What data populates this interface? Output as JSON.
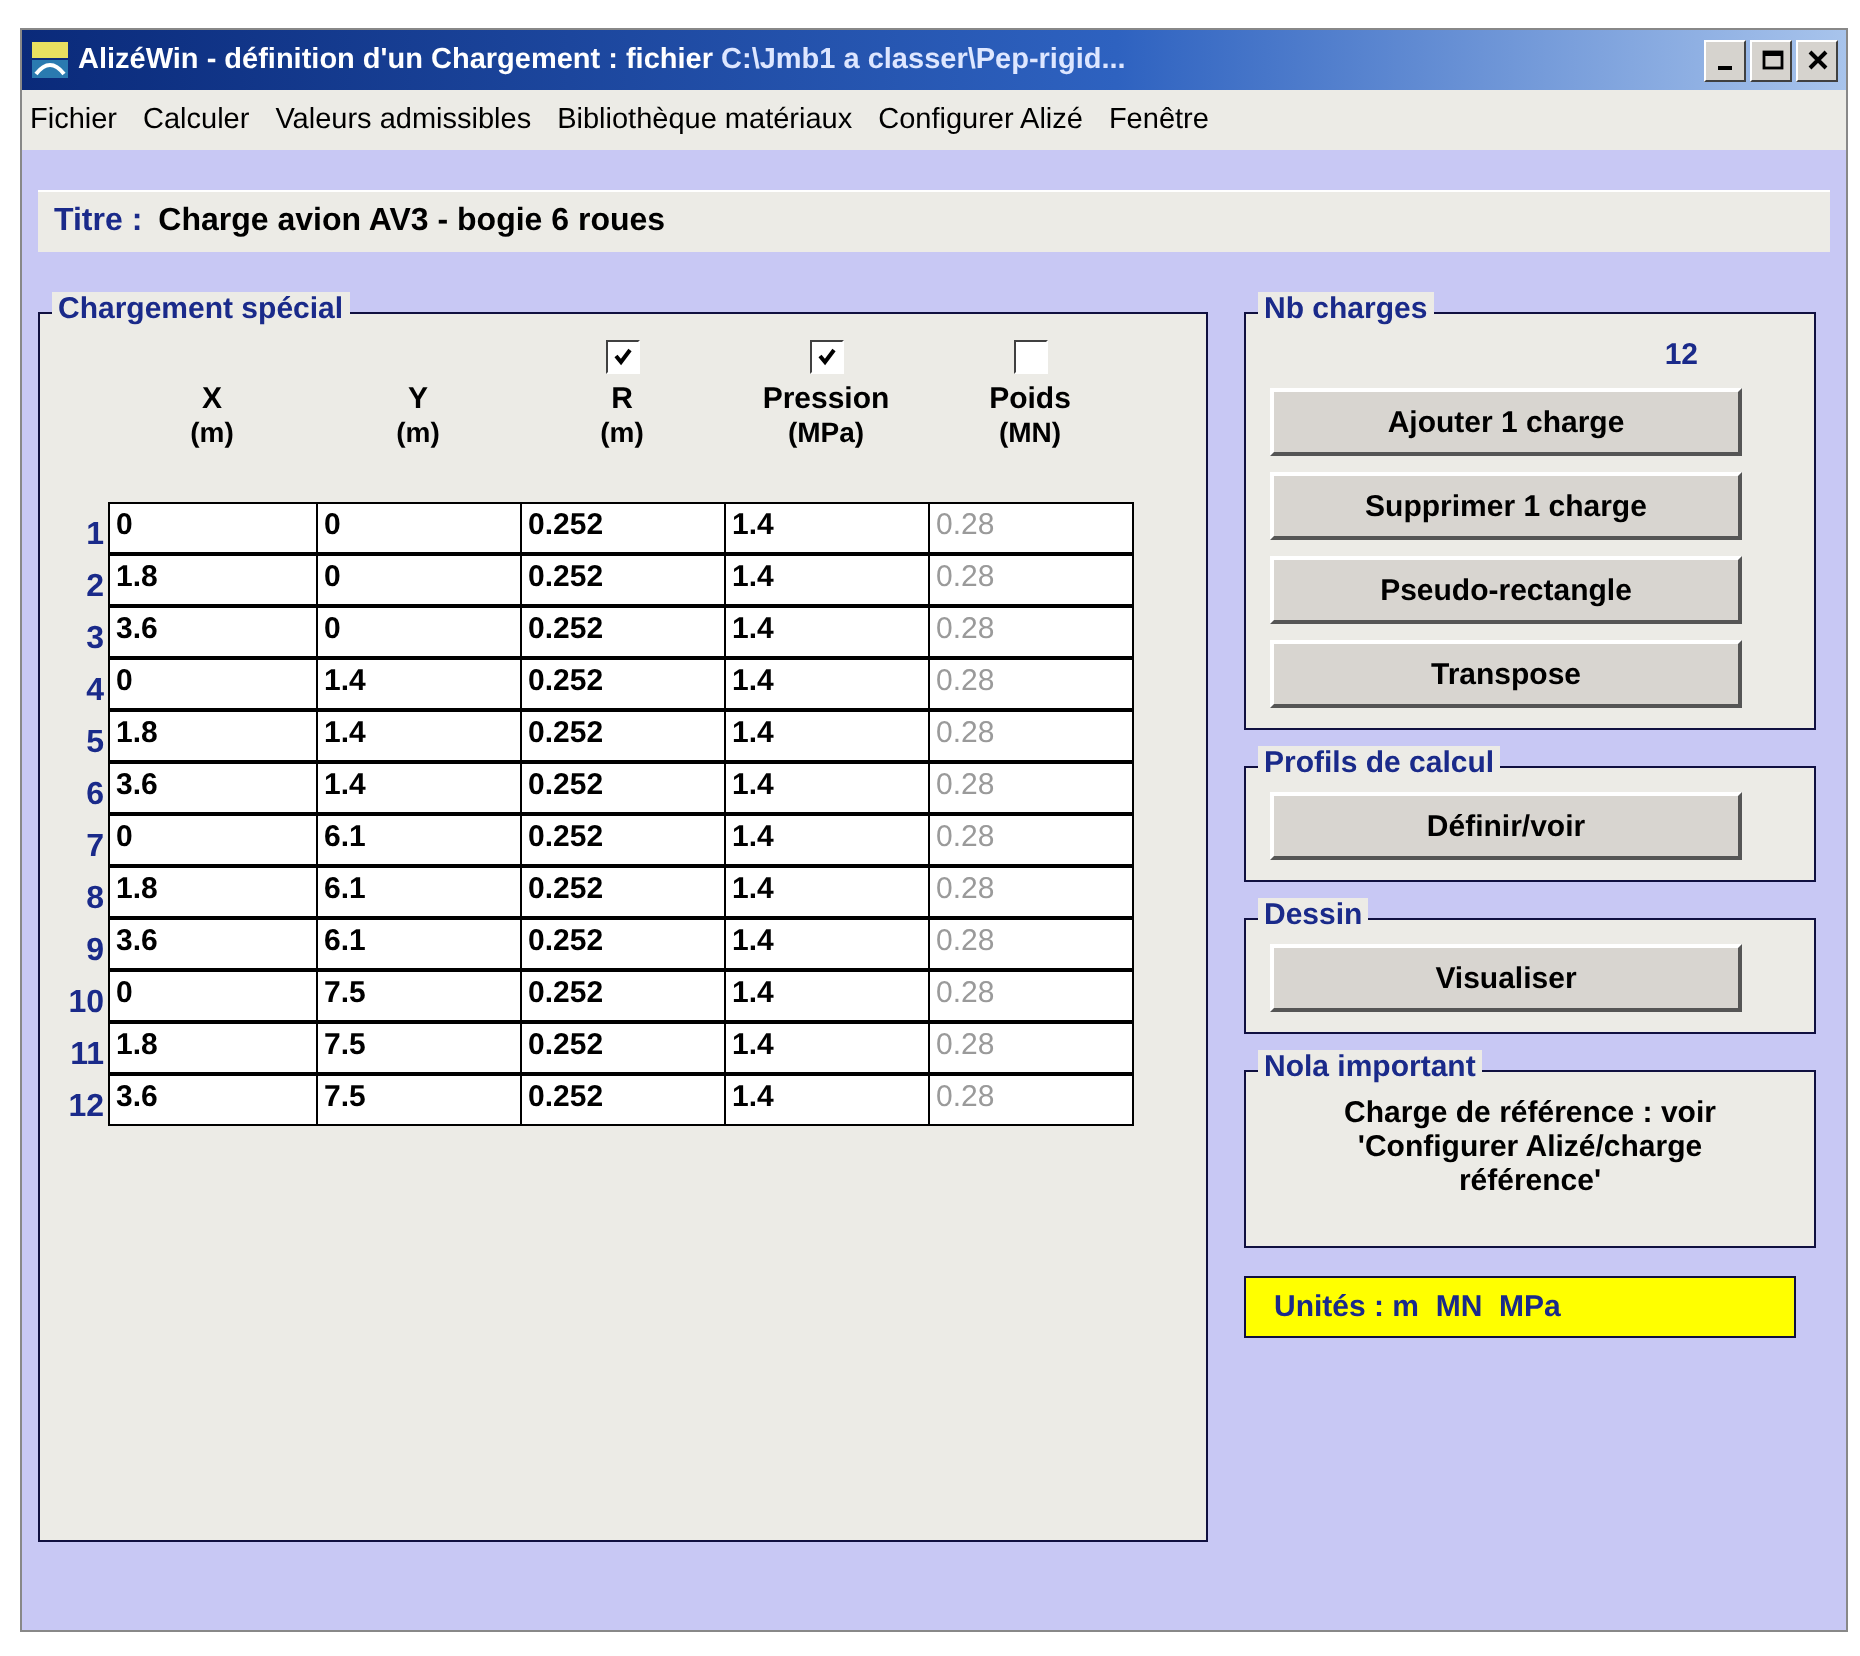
{
  "window": {
    "title": "AlizéWin - définition d'un Chargement : fichier ",
    "title_path": "C:\\Jmb1 a classer\\Pep-rigid..."
  },
  "menu": [
    "Fichier",
    "Calculer",
    "Valeurs admissibles",
    "Bibliothèque matériaux",
    "Configurer Alizé",
    "Fenêtre"
  ],
  "titre": {
    "label": "Titre :",
    "value": "Charge avion AV3 - bogie 6 roues"
  },
  "chargement": {
    "title": "Chargement spécial",
    "columns": [
      {
        "label": "X",
        "unit": "(m)"
      },
      {
        "label": "Y",
        "unit": "(m)"
      },
      {
        "label": "R",
        "unit": "(m)",
        "checked": true
      },
      {
        "label": "Pression",
        "unit": "(MPa)",
        "checked": true
      },
      {
        "label": "Poids",
        "unit": "(MN)",
        "checked": false
      }
    ],
    "rows": [
      {
        "number": "1",
        "cells": [
          "0",
          "0",
          "0.252",
          "1.4",
          "0.28"
        ]
      },
      {
        "number": "2",
        "cells": [
          "1.8",
          "0",
          "0.252",
          "1.4",
          "0.28"
        ]
      },
      {
        "number": "3",
        "cells": [
          "3.6",
          "0",
          "0.252",
          "1.4",
          "0.28"
        ]
      },
      {
        "number": "4",
        "cells": [
          "0",
          "1.4",
          "0.252",
          "1.4",
          "0.28"
        ]
      },
      {
        "number": "5",
        "cells": [
          "1.8",
          "1.4",
          "0.252",
          "1.4",
          "0.28"
        ]
      },
      {
        "number": "6",
        "cells": [
          "3.6",
          "1.4",
          "0.252",
          "1.4",
          "0.28"
        ]
      },
      {
        "number": "7",
        "cells": [
          "0",
          "6.1",
          "0.252",
          "1.4",
          "0.28"
        ]
      },
      {
        "number": "8",
        "cells": [
          "1.8",
          "6.1",
          "0.252",
          "1.4",
          "0.28"
        ]
      },
      {
        "number": "9",
        "cells": [
          "3.6",
          "6.1",
          "0.252",
          "1.4",
          "0.28"
        ]
      },
      {
        "number": "10",
        "cells": [
          "0",
          "7.5",
          "0.252",
          "1.4",
          "0.28"
        ]
      },
      {
        "number": "11",
        "cells": [
          "1.8",
          "7.5",
          "0.252",
          "1.4",
          "0.28"
        ]
      },
      {
        "number": "12",
        "cells": [
          "3.6",
          "7.5",
          "0.252",
          "1.4",
          "0.28"
        ]
      }
    ]
  },
  "groups": [
    {
      "title": "Nb charges",
      "count": "12",
      "buttons": [
        "Ajouter 1 charge",
        "Supprimer 1 charge",
        "Pseudo-rectangle",
        "Transpose"
      ]
    },
    {
      "title": "Profils de calcul",
      "buttons": [
        "Définir/voir"
      ]
    },
    {
      "title": "Dessin",
      "buttons": [
        "Visualiser"
      ]
    },
    {
      "title": "Nola important",
      "note": "Charge de référence : voir 'Configurer Alizé/charge référence'"
    }
  ],
  "units": "Unités : m  MN  MPa"
}
